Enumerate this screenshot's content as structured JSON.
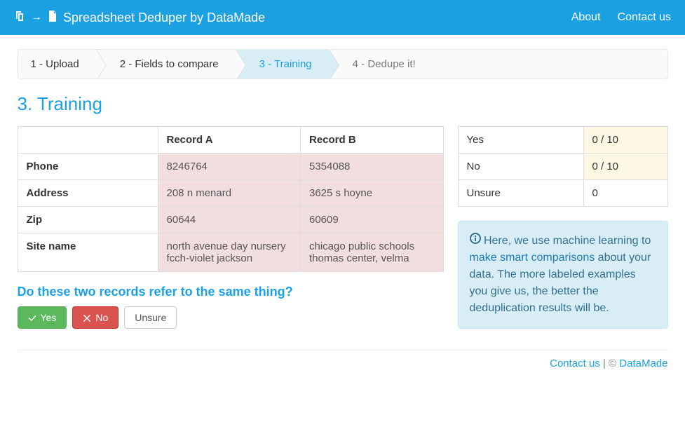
{
  "header": {
    "app_title": "Spreadsheet Deduper by DataMade",
    "nav": {
      "about": "About",
      "contact": "Contact us"
    }
  },
  "steps": {
    "s1": "1 - Upload",
    "s2": "2 - Fields to compare",
    "s3": "3 - Training",
    "s4": "4 - Dedupe it!"
  },
  "page_title": "3. Training",
  "compare": {
    "header_a": "Record A",
    "header_b": "Record B",
    "rows": [
      {
        "field": "Phone",
        "a": "8246764",
        "b": "5354088"
      },
      {
        "field": "Address",
        "a": "208 n menard",
        "b": "3625 s hoyne"
      },
      {
        "field": "Zip",
        "a": "60644",
        "b": "60609"
      },
      {
        "field": "Site name",
        "a": "north avenue day nursery fcch-violet jackson",
        "b": "chicago public schools thomas center, velma"
      }
    ]
  },
  "prompt": "Do these two records refer to the same thing?",
  "buttons": {
    "yes": "Yes",
    "no": "No",
    "unsure": "Unsure"
  },
  "counts": {
    "yes_label": "Yes",
    "yes_value": "0 / 10",
    "no_label": "No",
    "no_value": "0 / 10",
    "unsure_label": "Unsure",
    "unsure_value": "0"
  },
  "info": {
    "lead": "Here, we use machine learning to ",
    "link": "make smart comparisons",
    "rest": " about your data. The more labeled examples you give us, the better the deduplication results will be."
  },
  "footer": {
    "contact": "Contact us",
    "sep": " | © ",
    "brand": "DataMade"
  }
}
